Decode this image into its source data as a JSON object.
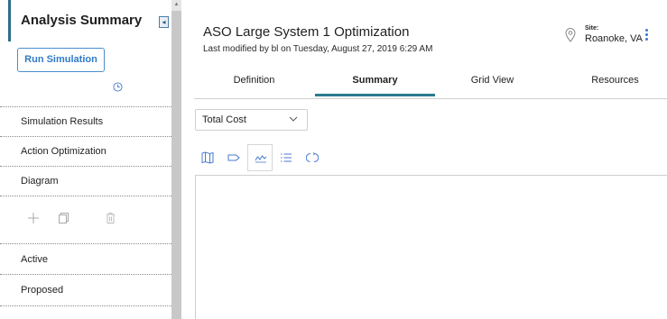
{
  "sidebar": {
    "title": "Analysis Summary",
    "run_button": "Run Simulation",
    "nav": [
      "Simulation Results",
      "Action Optimization",
      "Diagram"
    ],
    "lists": [
      "Active",
      "Proposed"
    ]
  },
  "header": {
    "title": "ASO Large System 1 Optimization",
    "subtitle": "Last modified by bl on Tuesday, August 27, 2019 6:29 AM",
    "site_label": "Site:",
    "site_value": "Roanoke, VA"
  },
  "tabs": [
    {
      "label": "Definition",
      "active": false
    },
    {
      "label": "Summary",
      "active": true
    },
    {
      "label": "Grid View",
      "active": false
    },
    {
      "label": "Resources",
      "active": false
    }
  ],
  "filter": {
    "selected": "Total Cost"
  },
  "view_icons": [
    "map-icon",
    "tag-icon",
    "line-chart-icon",
    "list-icon",
    "refresh-icon"
  ],
  "colors": {
    "accent": "#2b7a90",
    "link": "#2f7bc8",
    "menu_dots": "#3f78c8"
  }
}
